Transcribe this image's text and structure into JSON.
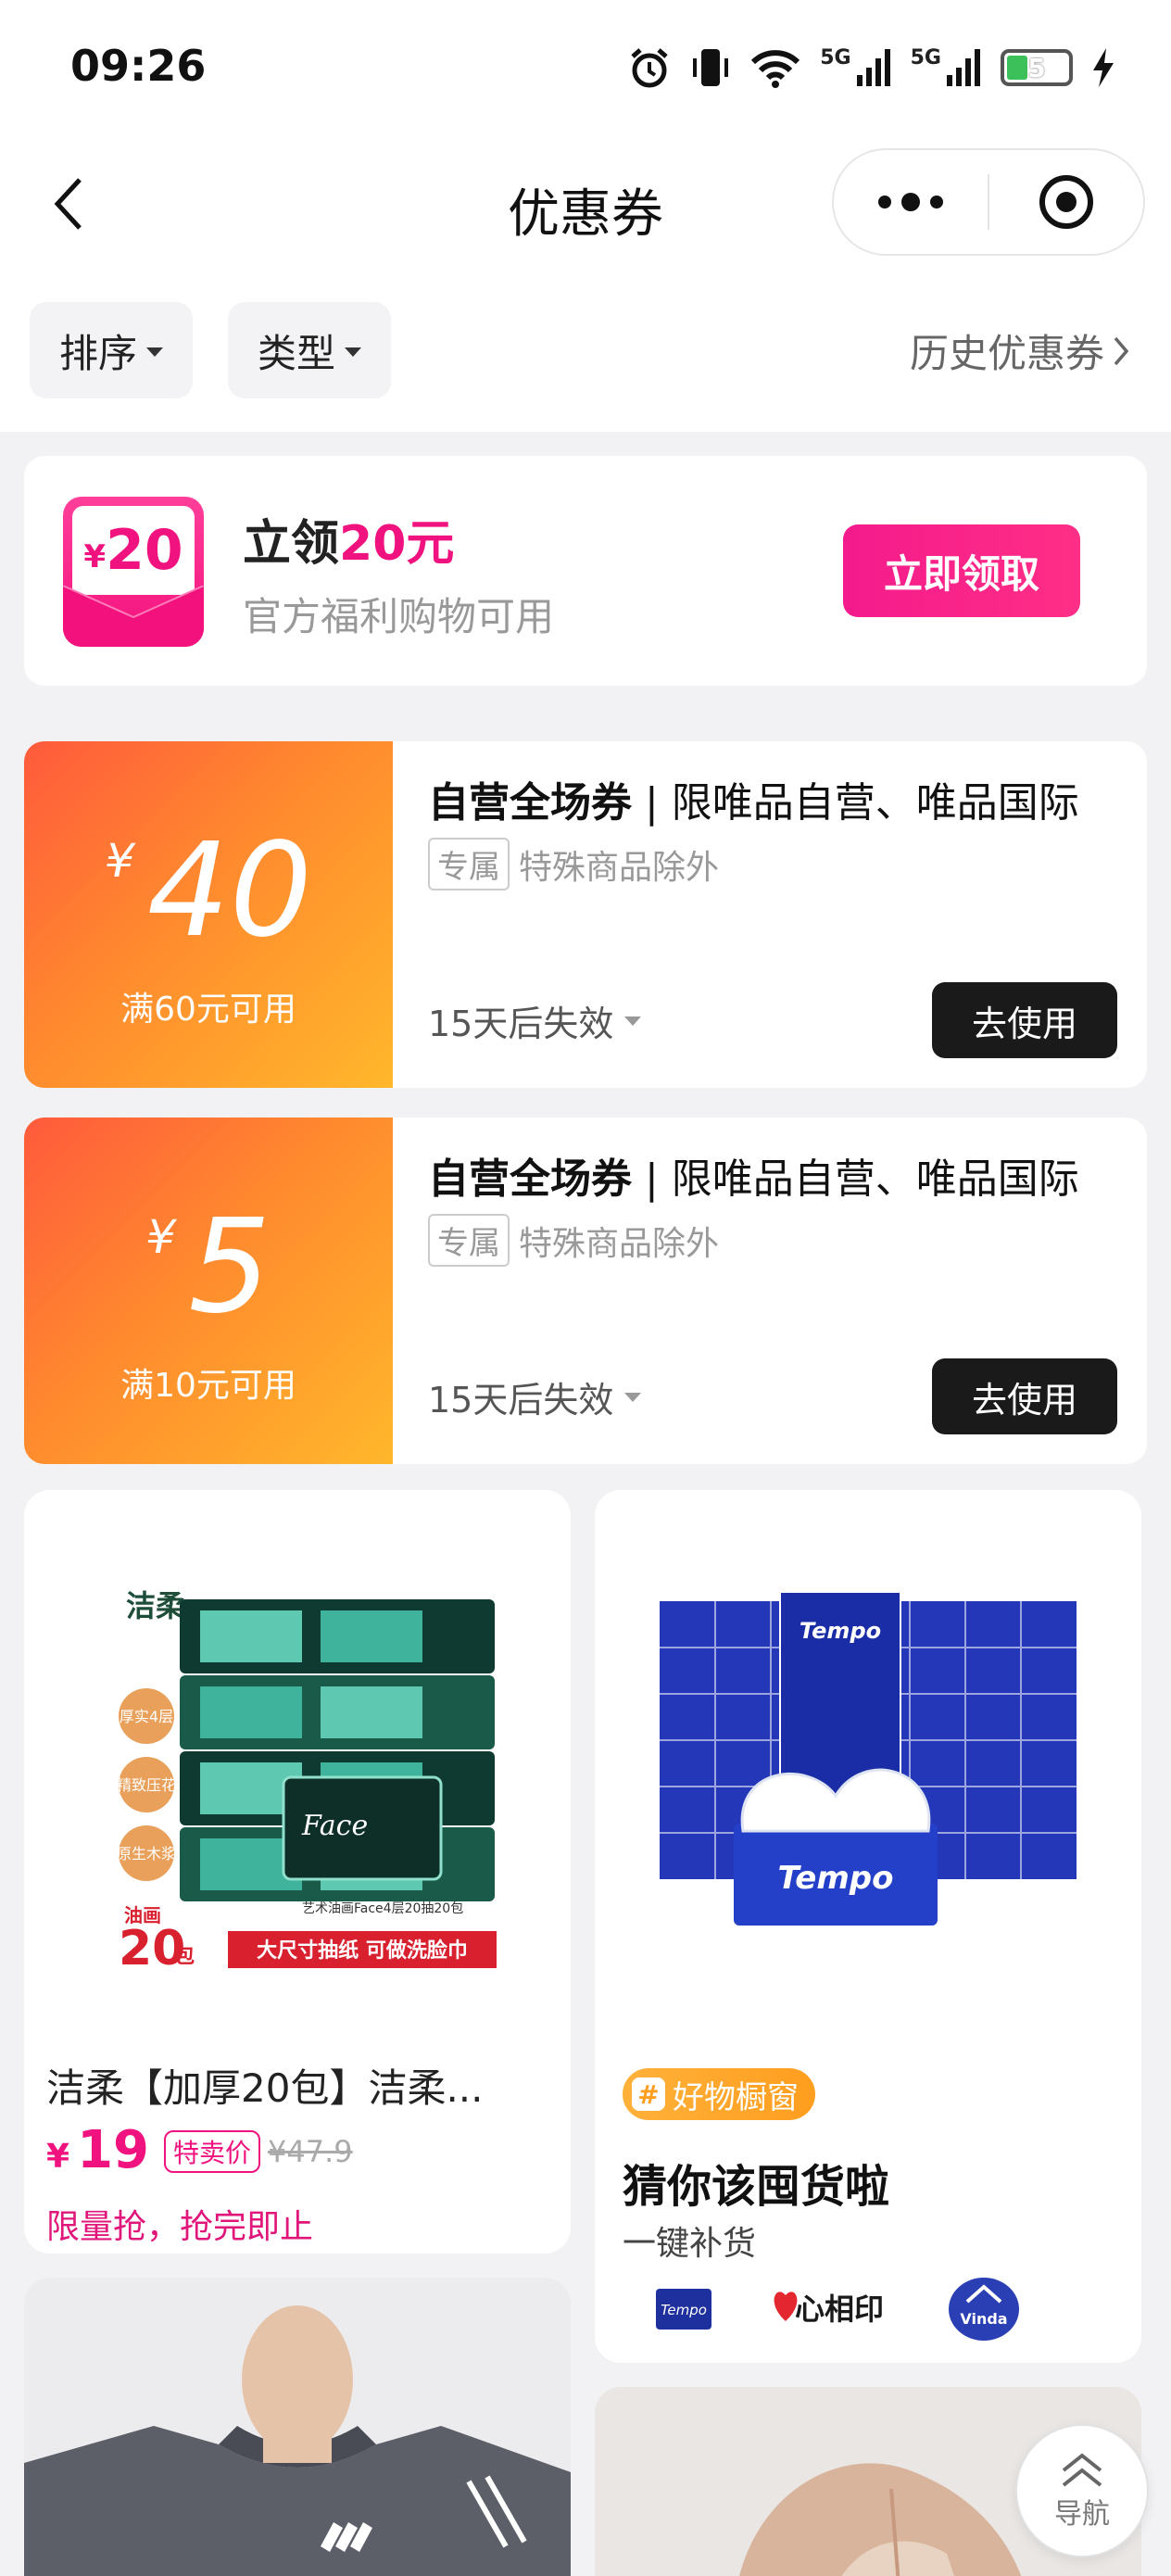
{
  "status_bar": {
    "time": "09:26",
    "signal_tag_1": "5G",
    "signal_tag_2": "5G",
    "battery": "5"
  },
  "nav": {
    "title": "优惠券"
  },
  "filters": {
    "sort_label": "排序",
    "type_label": "类型",
    "history_label": "历史优惠券"
  },
  "promo": {
    "icon_yen": "¥",
    "icon_amount": "20",
    "title_prefix": "立领",
    "title_highlight": "20元",
    "subtitle": "官方福利购物可用",
    "button_label": "立即领取"
  },
  "coupons": [
    {
      "currency": "¥",
      "amount": "40",
      "condition": "满60元可用",
      "title_bold": "自营全场券",
      "title_rest": "| 限唯品自营、唯品国际",
      "tag": "专属",
      "note": "特殊商品除外",
      "expire": "15天后失效",
      "button_label": "去使用"
    },
    {
      "currency": "¥",
      "amount": "5",
      "condition": "满10元可用",
      "title_bold": "自营全场券",
      "title_rest": "| 限唯品自营、唯品国际",
      "tag": "专属",
      "note": "特殊商品除外",
      "expire": "15天后失效",
      "button_label": "去使用"
    }
  ],
  "products": [
    {
      "brand_text": "洁柔",
      "image_labels": [
        "厚实4层",
        "精致压花",
        "原生木浆"
      ],
      "pack_face": "Face",
      "pack_caption": "艺术油画Face4层20抽20包",
      "image_count_small": "油画",
      "image_count_big": "20",
      "image_count_unit": "包",
      "image_banner": "大尺寸抽纸 可做洗脸巾",
      "name": "洁柔【加厚20包】洁柔...",
      "currency": "¥",
      "price": "19",
      "badge": "特卖价",
      "original_price": "¥47.9",
      "note": "限量抢，抢完即止"
    }
  ],
  "shop_window": {
    "badge_hash": "#",
    "badge_label": "好物橱窗",
    "title": "猜你该囤货啦",
    "subtitle": "一键补货",
    "image_brand": "Tempo",
    "brands": [
      "Tempo",
      "心相印",
      "Vinda"
    ]
  },
  "float_nav": {
    "label": "导航"
  },
  "colors": {
    "accent_pink": "#f0137f",
    "coupon_orange": "#ff8a2e",
    "badge_orange": "#ff9e1f"
  }
}
